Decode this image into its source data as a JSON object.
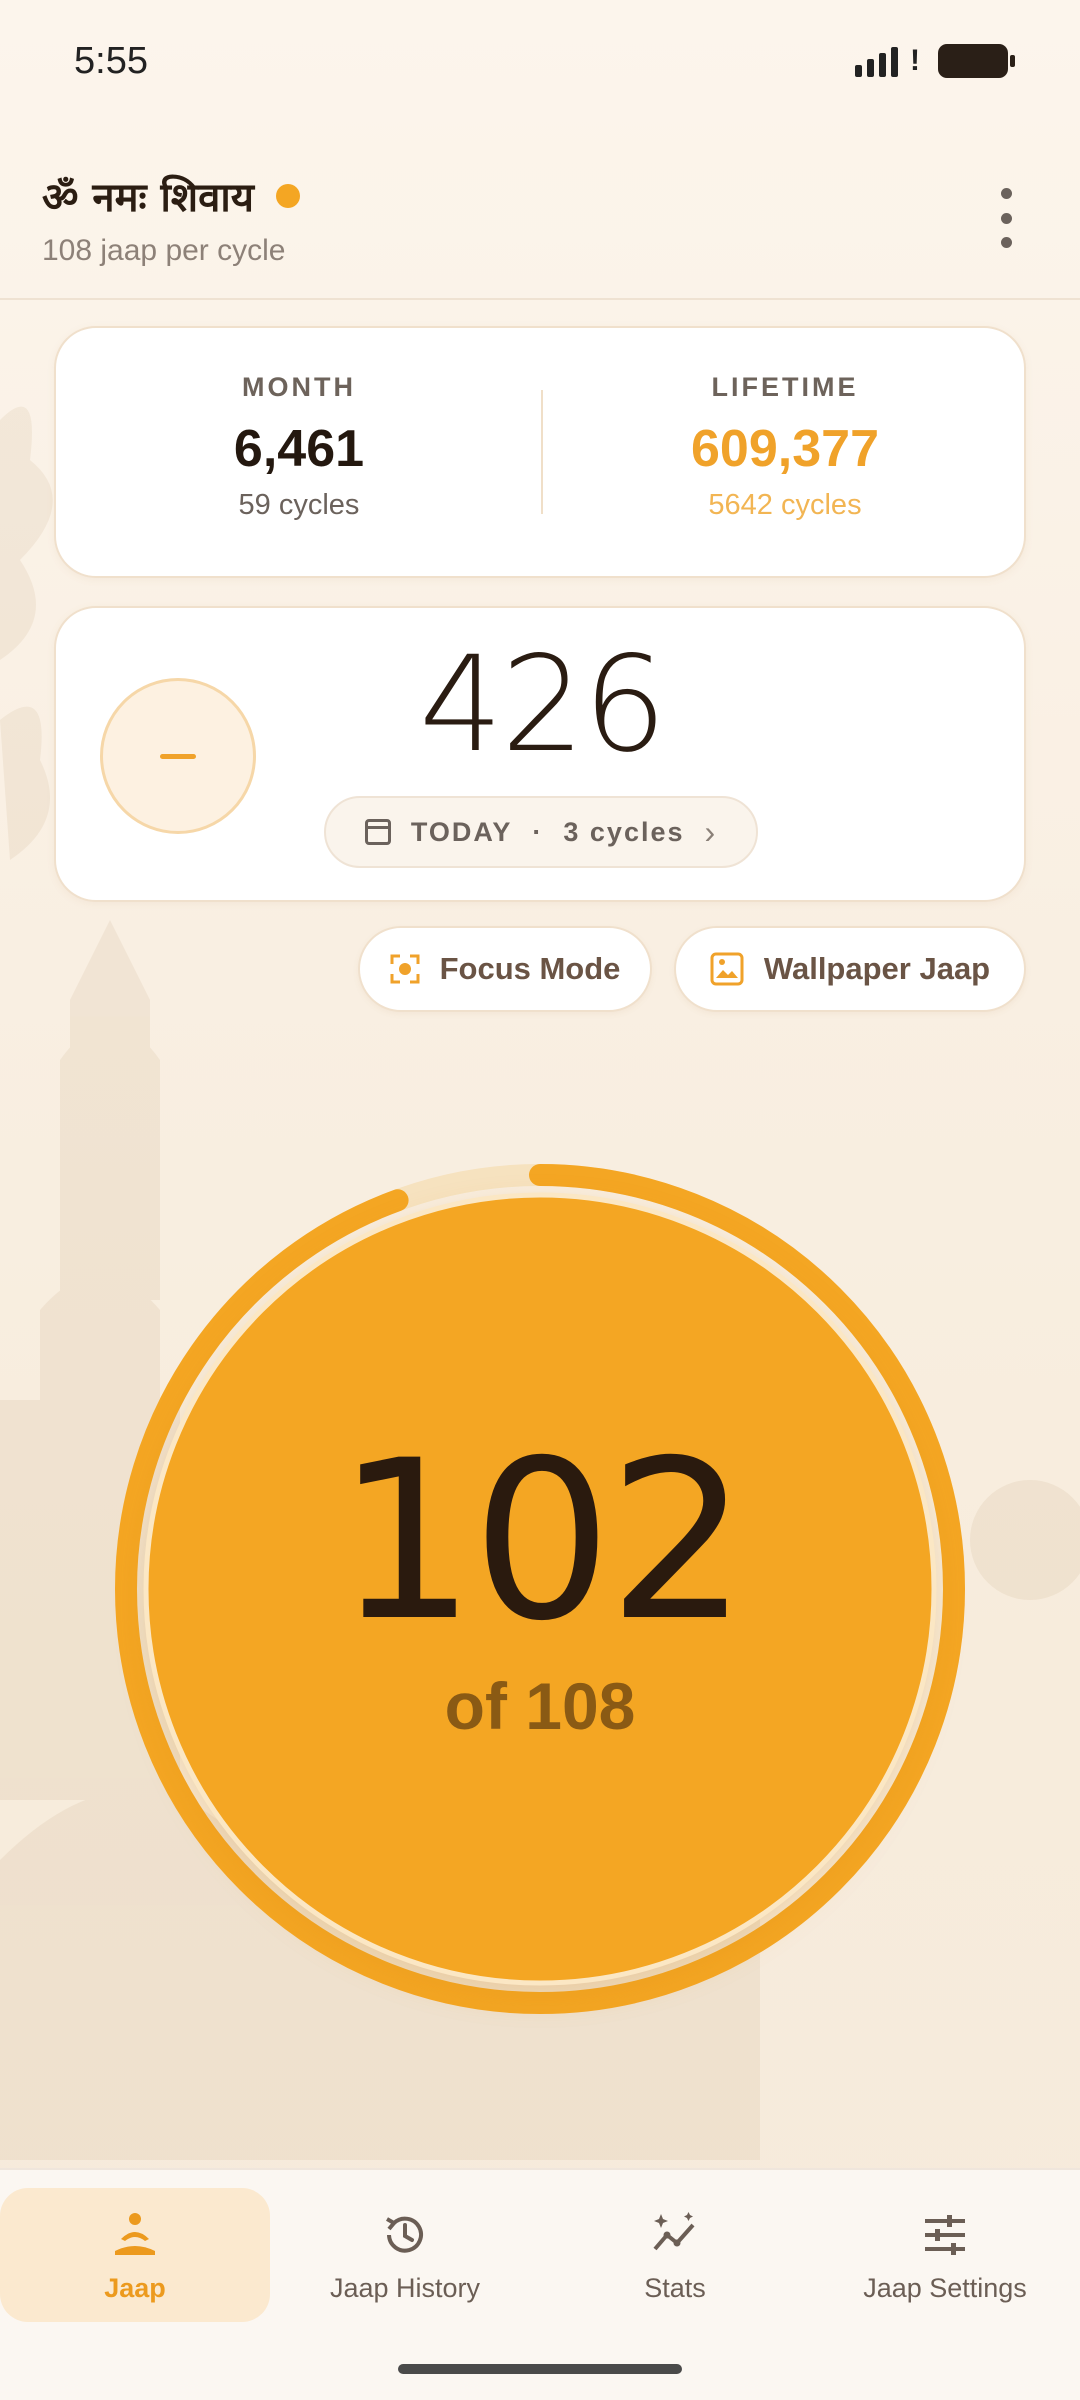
{
  "status_bar": {
    "time": "5:55"
  },
  "header": {
    "mantra_title": "ॐ नमः शिवाय",
    "subtitle": "108 jaap per cycle",
    "menu_icon": "more-vert-icon"
  },
  "stats": {
    "month": {
      "label": "MONTH",
      "value": "6,461",
      "cycles": "59 cycles"
    },
    "lifetime": {
      "label": "LIFETIME",
      "value": "609,377",
      "cycles": "5642 cycles"
    }
  },
  "today": {
    "count": "426",
    "label": "TODAY",
    "separator": "·",
    "cycles": "3 cycles"
  },
  "actions": {
    "focus_mode": "Focus Mode",
    "wallpaper_jaap": "Wallpaper Jaap"
  },
  "counter": {
    "current": "102",
    "of_label": "of 108",
    "progress_fraction": 0.944
  },
  "nav": {
    "items": [
      {
        "label": "Jaap",
        "icon": "meditation-icon",
        "active": true
      },
      {
        "label": "Jaap History",
        "icon": "history-icon",
        "active": false
      },
      {
        "label": "Stats",
        "icon": "stats-icon",
        "active": false
      },
      {
        "label": "Jaap Settings",
        "icon": "tune-icon",
        "active": false
      }
    ]
  },
  "colors": {
    "accent": "#f4a623",
    "accent_text": "#f0a22a",
    "background": "#fbf4ea",
    "text_dark": "#2b1d12"
  }
}
